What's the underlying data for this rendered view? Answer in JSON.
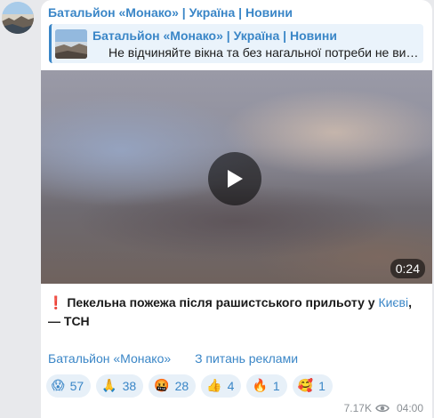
{
  "channel": {
    "name": "Батальйон «Монако» | Україна | Новини"
  },
  "reply": {
    "title": "Батальйон «Монако» | Україна | Новини",
    "text": "Не відчиняйте вікна та без нагальної потреби не виходьте на вулицю"
  },
  "video": {
    "duration": "0:24"
  },
  "caption": {
    "emoji": "❗",
    "text": "Пекельна пожежа після рашистського прильоту у ",
    "link": "Києві",
    "tail": ", — ТСН"
  },
  "links": {
    "channel": "Батальйон «Монако»",
    "ads": "З питань реклами"
  },
  "reactions": [
    {
      "emoji": "😱",
      "icon": "screaming-face-icon",
      "count": "57"
    },
    {
      "emoji": "🙏",
      "icon": "folded-hands-icon",
      "count": "38"
    },
    {
      "emoji": "🤬",
      "icon": "cursing-face-icon",
      "count": "28"
    },
    {
      "emoji": "👍",
      "icon": "thumbs-up-icon",
      "count": "4"
    },
    {
      "emoji": "🔥",
      "icon": "fire-icon",
      "count": "1"
    },
    {
      "emoji": "🥰",
      "icon": "smiling-hearts-icon",
      "count": "1"
    }
  ],
  "meta": {
    "views": "7.17K",
    "time": "04:00"
  },
  "colors": {
    "accent": "#3a86c7",
    "reaction_bg": "#e7f0f8",
    "reply_bg": "#eaf3fb"
  }
}
